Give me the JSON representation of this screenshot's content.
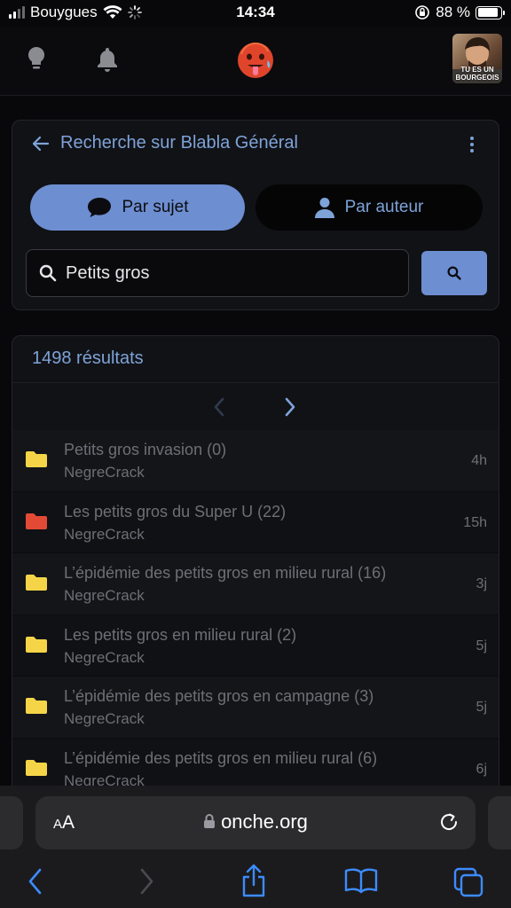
{
  "status_bar": {
    "carrier": "Bouygues",
    "time": "14:34",
    "battery_percent": "88 %",
    "battery_level": 0.88
  },
  "header": {
    "icons": [
      "lightbulb-icon",
      "bell-icon",
      "logo-face-icon"
    ],
    "avatar_caption": "TU ES UN BOURGEOIS"
  },
  "search": {
    "title": "Recherche sur Blabla Général",
    "tab_subject": "Par sujet",
    "tab_author": "Par auteur",
    "query": "Petits gros",
    "accent_color": "#6d8ed1"
  },
  "results": {
    "count_label": "1498 résultats",
    "items": [
      {
        "title": "Petits gros invasion (0)",
        "author": "NegreCrack",
        "time": "4h",
        "folder_color": "#f5d547"
      },
      {
        "title": "Les petits gros du Super U (22)",
        "author": "NegreCrack",
        "time": "15h",
        "folder_color": "#e34a36"
      },
      {
        "title": "L’épidémie des petits gros en milieu rural (16)",
        "author": "NegreCrack",
        "time": "3j",
        "folder_color": "#f5d547"
      },
      {
        "title": "Les petits gros en milieu rural (2)",
        "author": "NegreCrack",
        "time": "5j",
        "folder_color": "#f5d547"
      },
      {
        "title": "L’épidémie des petits gros en campagne (3)",
        "author": "NegreCrack",
        "time": "5j",
        "folder_color": "#f5d547"
      },
      {
        "title": "L’épidémie des petits gros en milieu rural (6)",
        "author": "NegreCrack",
        "time": "6j",
        "folder_color": "#f5d547"
      }
    ]
  },
  "browser": {
    "text_size_label_small": "A",
    "text_size_label_large": "A",
    "url": "onche.org"
  }
}
